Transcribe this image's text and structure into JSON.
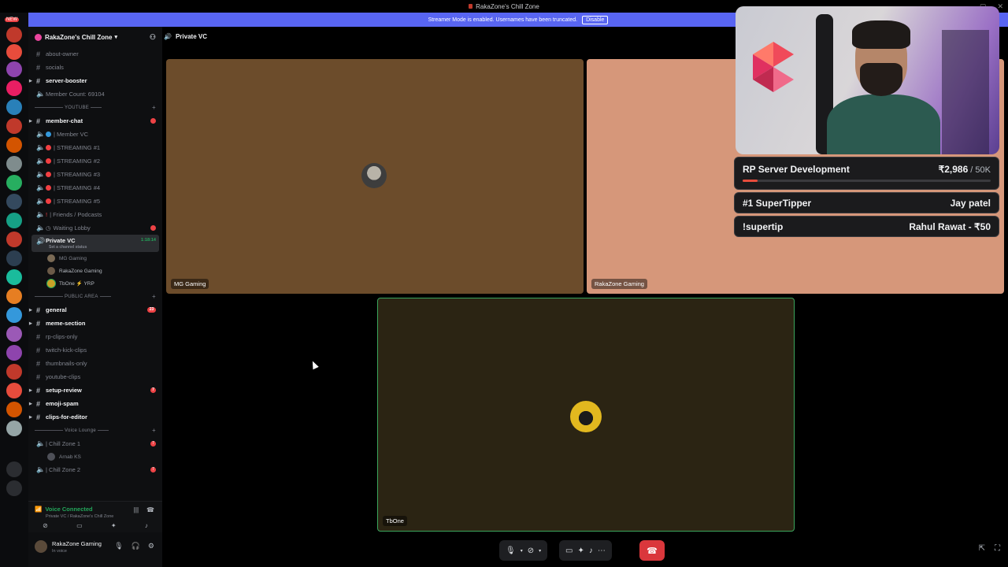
{
  "window": {
    "title": "RakaZone's Chill Zone"
  },
  "banner": {
    "text": "Streamer Mode is enabled. Usernames have been truncated.",
    "button": "Disable"
  },
  "rail": {
    "new_label": "NEW"
  },
  "guild": {
    "name": "RakaZone's Chill Zone"
  },
  "channels_top": [
    {
      "name": "about-owner",
      "type": "text",
      "bold": false
    },
    {
      "name": "socials",
      "type": "text",
      "bold": false
    },
    {
      "name": "server-booster",
      "type": "text",
      "bold": true
    },
    {
      "name": "Member Count: 69104",
      "type": "voice",
      "bold": false
    }
  ],
  "categories": {
    "youtube": "YOUTUBE",
    "public": "PUBLIC AREA",
    "voice": "Voice Lounge"
  },
  "youtube_channels": [
    {
      "name": "member-chat",
      "type": "text",
      "bold": true,
      "badge": ""
    },
    {
      "name": "| Member VC",
      "type": "voice"
    },
    {
      "name": "| STREAMING #1",
      "type": "voice"
    },
    {
      "name": "| STREAMING #2",
      "type": "voice"
    },
    {
      "name": "| STREAMING #3",
      "type": "voice"
    },
    {
      "name": "| STREAMING #4",
      "type": "voice"
    },
    {
      "name": "| STREAMING #5",
      "type": "voice"
    },
    {
      "name": "| Friends / Podcasts",
      "type": "voice"
    },
    {
      "name": "Waiting Lobby",
      "type": "voice",
      "badge": ""
    }
  ],
  "private_vc": {
    "name": "Private VC",
    "status": "Set a channel status",
    "timer": "1:18:14"
  },
  "voice_members": [
    {
      "name": "MG Gaming"
    },
    {
      "name": "RakaZone Gaming"
    },
    {
      "name": "TbOne ⚡ YRP"
    }
  ],
  "public_channels": [
    {
      "name": "general",
      "bold": true,
      "badge": "23"
    },
    {
      "name": "meme-section",
      "bold": true,
      "badge": ""
    },
    {
      "name": "rp-clips-only",
      "bold": false,
      "badge": ""
    },
    {
      "name": "twitch-kick-clips",
      "bold": false,
      "badge": ""
    },
    {
      "name": "thumbnails-only",
      "bold": false,
      "badge": ""
    },
    {
      "name": "youtube-clips",
      "bold": false,
      "badge": ""
    },
    {
      "name": "setup-review",
      "bold": true,
      "badge": "7"
    },
    {
      "name": "emoji-spam",
      "bold": true,
      "badge": ""
    },
    {
      "name": "clips-for-editor",
      "bold": true,
      "badge": ""
    }
  ],
  "voice_lounge": [
    {
      "name": "| Chill Zone 1",
      "badge": "7"
    },
    {
      "name": "| Chill Zone 2",
      "badge": "7"
    }
  ],
  "lounge_member": "Arnab KS",
  "voice_status": {
    "title": "Voice Connected",
    "sub": "Private VC / RakaZone's Chill Zone"
  },
  "user": {
    "name": "RakaZone Gaming",
    "status": "In voice"
  },
  "call": {
    "title": "Private VC"
  },
  "tiles": {
    "mg": "MG Gaming",
    "raka": "RakaZone Gaming",
    "tb": "TbOne"
  },
  "widgets": {
    "goal_title": "RP Server Development",
    "goal_amount": "₹2,986",
    "goal_limit": " / 50K",
    "goal_progress": 0.06,
    "supertipper_label": "#1 SuperTipper",
    "supertipper_name": "Jay patel",
    "tip_cmd": "!supertip",
    "tip_value": "Rahul Rawat - ₹50"
  },
  "colors": {
    "accent": "#5865f2",
    "voice_green": "#23a55a",
    "hangup": "#da373c"
  }
}
